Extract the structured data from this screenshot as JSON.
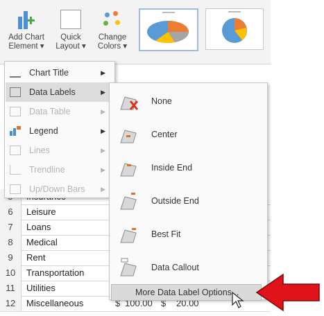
{
  "ribbon": {
    "add_chart_element": "Add Chart\nElement ▾",
    "quick_layout": "Quick\nLayout ▾",
    "change_colors": "Change\nColors ▾"
  },
  "chart_element_menu": {
    "items": [
      {
        "label": "Chart Title",
        "enabled": true
      },
      {
        "label": "Data Labels",
        "enabled": true
      },
      {
        "label": "Data Table",
        "enabled": false
      },
      {
        "label": "Legend",
        "enabled": true
      },
      {
        "label": "Lines",
        "enabled": false
      },
      {
        "label": "Trendline",
        "enabled": false
      },
      {
        "label": "Up/Down Bars",
        "enabled": false
      }
    ]
  },
  "data_labels_menu": {
    "items": [
      {
        "label": "None"
      },
      {
        "label": "Center"
      },
      {
        "label": "Inside End"
      },
      {
        "label": "Outside End"
      },
      {
        "label": "Best Fit"
      },
      {
        "label": "Data Callout"
      }
    ],
    "more_options": "More Data Label Options..."
  },
  "sheet": {
    "rows": [
      {
        "num": "5",
        "name": "Insurance"
      },
      {
        "num": "6",
        "name": "Leisure"
      },
      {
        "num": "7",
        "name": "Loans"
      },
      {
        "num": "8",
        "name": "Medical"
      },
      {
        "num": "9",
        "name": "Rent"
      },
      {
        "num": "10",
        "name": "Transportation"
      },
      {
        "num": "11",
        "name": "Utilities"
      },
      {
        "num": "12",
        "name": "Miscellaneous"
      }
    ],
    "last_row_values": {
      "currency": "$",
      "amount1": "100.00",
      "symbol": "$",
      "amount2": "20.00"
    }
  },
  "colors": {
    "accent_arrow": "#e0121a",
    "menu_hover": "#dcdcdc"
  }
}
